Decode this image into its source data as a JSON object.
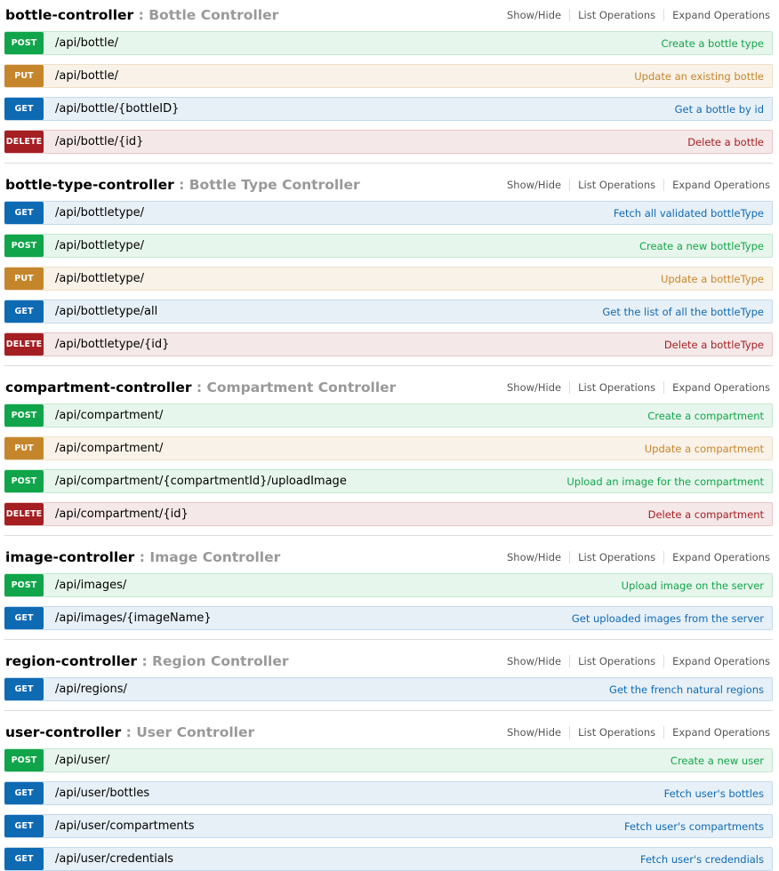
{
  "options_labels": {
    "show_hide": "Show/Hide",
    "list_operations": "List Operations",
    "expand_operations": "Expand Operations"
  },
  "method_colors": {
    "post": "#10a54a",
    "put": "#c5862b",
    "get": "#0f6ab4",
    "delete": "#a41e22"
  },
  "resources": [
    {
      "name": "bottle-controller",
      "separator": " : ",
      "description": "Bottle Controller",
      "operations": [
        {
          "method": "POST",
          "path": "/api/bottle/",
          "summary": "Create a bottle type"
        },
        {
          "method": "PUT",
          "path": "/api/bottle/",
          "summary": "Update an existing bottle"
        },
        {
          "method": "GET",
          "path": "/api/bottle/{bottleID}",
          "summary": "Get a bottle by id"
        },
        {
          "method": "DELETE",
          "path": "/api/bottle/{id}",
          "summary": "Delete a bottle"
        }
      ]
    },
    {
      "name": "bottle-type-controller",
      "separator": " : ",
      "description": "Bottle Type Controller",
      "operations": [
        {
          "method": "GET",
          "path": "/api/bottletype/",
          "summary": "Fetch all validated bottleType"
        },
        {
          "method": "POST",
          "path": "/api/bottletype/",
          "summary": "Create a new bottleType"
        },
        {
          "method": "PUT",
          "path": "/api/bottletype/",
          "summary": "Update a bottleType"
        },
        {
          "method": "GET",
          "path": "/api/bottletype/all",
          "summary": "Get the list of all the bottleType"
        },
        {
          "method": "DELETE",
          "path": "/api/bottletype/{id}",
          "summary": "Delete a bottleType"
        }
      ]
    },
    {
      "name": "compartment-controller",
      "separator": " : ",
      "description": "Compartment Controller",
      "operations": [
        {
          "method": "POST",
          "path": "/api/compartment/",
          "summary": "Create a compartment"
        },
        {
          "method": "PUT",
          "path": "/api/compartment/",
          "summary": "Update a compartment"
        },
        {
          "method": "POST",
          "path": "/api/compartment/{compartmentId}/uploadImage",
          "summary": "Upload an image for the compartment"
        },
        {
          "method": "DELETE",
          "path": "/api/compartment/{id}",
          "summary": "Delete a compartment"
        }
      ]
    },
    {
      "name": "image-controller",
      "separator": " : ",
      "description": "Image Controller",
      "operations": [
        {
          "method": "POST",
          "path": "/api/images/",
          "summary": "Upload image on the server"
        },
        {
          "method": "GET",
          "path": "/api/images/{imageName}",
          "summary": "Get uploaded images from the server"
        }
      ]
    },
    {
      "name": "region-controller",
      "separator": " : ",
      "description": "Region Controller",
      "operations": [
        {
          "method": "GET",
          "path": "/api/regions/",
          "summary": "Get the french natural regions"
        }
      ]
    },
    {
      "name": "user-controller",
      "separator": " : ",
      "description": "User Controller",
      "operations": [
        {
          "method": "POST",
          "path": "/api/user/",
          "summary": "Create a new user"
        },
        {
          "method": "GET",
          "path": "/api/user/bottles",
          "summary": "Fetch user's bottles"
        },
        {
          "method": "GET",
          "path": "/api/user/compartments",
          "summary": "Fetch user's compartments"
        },
        {
          "method": "GET",
          "path": "/api/user/credentials",
          "summary": "Fetch user's credendials"
        }
      ]
    }
  ]
}
